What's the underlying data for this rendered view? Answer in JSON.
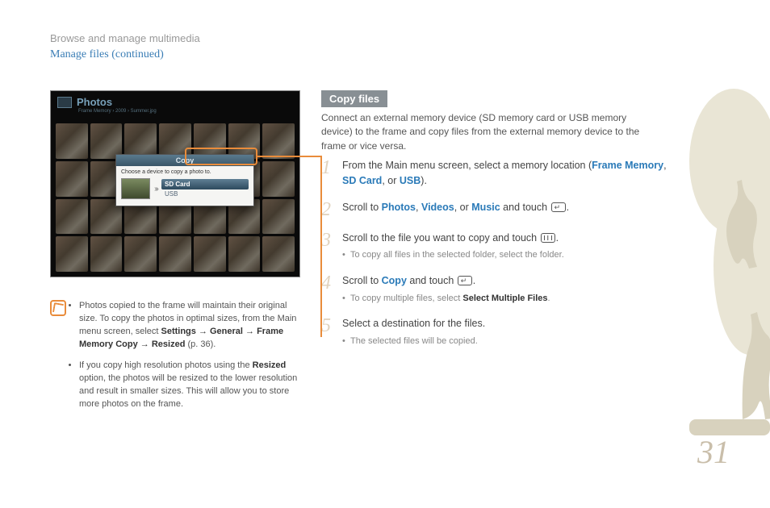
{
  "header": {
    "breadcrumb": "Browse and manage multimedia",
    "subtitle": "Manage files  (continued)"
  },
  "screenshot": {
    "title": "Photos",
    "path": "Frame Memory › 2009 › Summer.jpg",
    "dialog": {
      "title": "Copy",
      "prompt": "Choose a device to copy a photo to.",
      "selected": "SD Card",
      "other": "USB"
    }
  },
  "notes": [
    {
      "pre": "Photos copied to the frame will maintain their original size. To copy the photos in optimal sizes, from the Main menu screen, select ",
      "path": "Settings → General → Frame Memory Copy → Resized",
      "post": " (p. 36)."
    },
    {
      "pre": "If you copy high resolution photos using the ",
      "path": "Resized",
      "post": " option, the photos will be resized to the lower resolution and result in smaller sizes. This will allow you to store more photos on the frame."
    }
  ],
  "section": {
    "label": "Copy files",
    "intro": "Connect an external memory device (SD memory card or USB memory device) to the frame and copy files from the external memory device to the frame or vice versa."
  },
  "steps": {
    "s1": {
      "text_pre": "From the Main menu screen, select a memory location (",
      "opt1": "Frame Memory",
      "sep1": ", ",
      "opt2": "SD Card",
      "sep2": ", or ",
      "opt3": "USB",
      "text_post": ")."
    },
    "s2": {
      "pre": "Scroll to ",
      "o1": "Photos",
      "c1": ", ",
      "o2": "Videos",
      "c2": ", or ",
      "o3": "Music",
      "post": " and touch "
    },
    "s3": {
      "text": "Scroll to the file you want to copy and touch ",
      "sub": "To copy all files in the selected folder, select the folder."
    },
    "s4": {
      "pre": "Scroll to ",
      "o1": "Copy",
      "post": " and touch ",
      "sub_pre": "To copy multiple files, select ",
      "sub_bold": "Select Multiple Files",
      "sub_post": "."
    },
    "s5": {
      "text": "Select a destination for the files.",
      "sub": "The selected files will be copied."
    }
  },
  "page_number": "31"
}
